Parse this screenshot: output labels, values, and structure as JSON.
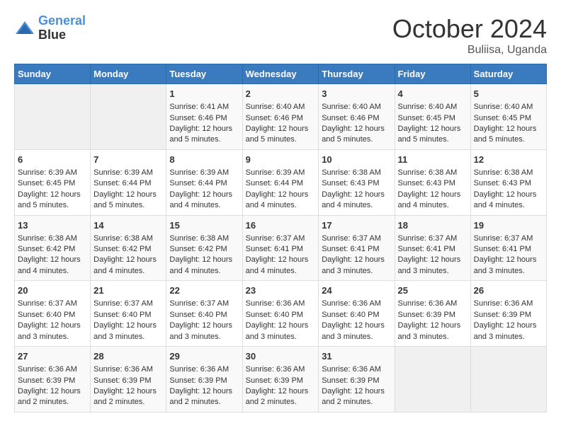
{
  "logo": {
    "line1": "General",
    "line2": "Blue"
  },
  "title": "October 2024",
  "subtitle": "Buliisa, Uganda",
  "days_of_week": [
    "Sunday",
    "Monday",
    "Tuesday",
    "Wednesday",
    "Thursday",
    "Friday",
    "Saturday"
  ],
  "weeks": [
    [
      {
        "day": "",
        "empty": true
      },
      {
        "day": "",
        "empty": true
      },
      {
        "day": "1",
        "sunrise": "6:41 AM",
        "sunset": "6:46 PM",
        "daylight": "12 hours and 5 minutes."
      },
      {
        "day": "2",
        "sunrise": "6:40 AM",
        "sunset": "6:46 PM",
        "daylight": "12 hours and 5 minutes."
      },
      {
        "day": "3",
        "sunrise": "6:40 AM",
        "sunset": "6:46 PM",
        "daylight": "12 hours and 5 minutes."
      },
      {
        "day": "4",
        "sunrise": "6:40 AM",
        "sunset": "6:45 PM",
        "daylight": "12 hours and 5 minutes."
      },
      {
        "day": "5",
        "sunrise": "6:40 AM",
        "sunset": "6:45 PM",
        "daylight": "12 hours and 5 minutes."
      }
    ],
    [
      {
        "day": "6",
        "sunrise": "6:39 AM",
        "sunset": "6:45 PM",
        "daylight": "12 hours and 5 minutes."
      },
      {
        "day": "7",
        "sunrise": "6:39 AM",
        "sunset": "6:44 PM",
        "daylight": "12 hours and 5 minutes."
      },
      {
        "day": "8",
        "sunrise": "6:39 AM",
        "sunset": "6:44 PM",
        "daylight": "12 hours and 4 minutes."
      },
      {
        "day": "9",
        "sunrise": "6:39 AM",
        "sunset": "6:44 PM",
        "daylight": "12 hours and 4 minutes."
      },
      {
        "day": "10",
        "sunrise": "6:38 AM",
        "sunset": "6:43 PM",
        "daylight": "12 hours and 4 minutes."
      },
      {
        "day": "11",
        "sunrise": "6:38 AM",
        "sunset": "6:43 PM",
        "daylight": "12 hours and 4 minutes."
      },
      {
        "day": "12",
        "sunrise": "6:38 AM",
        "sunset": "6:43 PM",
        "daylight": "12 hours and 4 minutes."
      }
    ],
    [
      {
        "day": "13",
        "sunrise": "6:38 AM",
        "sunset": "6:42 PM",
        "daylight": "12 hours and 4 minutes."
      },
      {
        "day": "14",
        "sunrise": "6:38 AM",
        "sunset": "6:42 PM",
        "daylight": "12 hours and 4 minutes."
      },
      {
        "day": "15",
        "sunrise": "6:38 AM",
        "sunset": "6:42 PM",
        "daylight": "12 hours and 4 minutes."
      },
      {
        "day": "16",
        "sunrise": "6:37 AM",
        "sunset": "6:41 PM",
        "daylight": "12 hours and 4 minutes."
      },
      {
        "day": "17",
        "sunrise": "6:37 AM",
        "sunset": "6:41 PM",
        "daylight": "12 hours and 3 minutes."
      },
      {
        "day": "18",
        "sunrise": "6:37 AM",
        "sunset": "6:41 PM",
        "daylight": "12 hours and 3 minutes."
      },
      {
        "day": "19",
        "sunrise": "6:37 AM",
        "sunset": "6:41 PM",
        "daylight": "12 hours and 3 minutes."
      }
    ],
    [
      {
        "day": "20",
        "sunrise": "6:37 AM",
        "sunset": "6:40 PM",
        "daylight": "12 hours and 3 minutes."
      },
      {
        "day": "21",
        "sunrise": "6:37 AM",
        "sunset": "6:40 PM",
        "daylight": "12 hours and 3 minutes."
      },
      {
        "day": "22",
        "sunrise": "6:37 AM",
        "sunset": "6:40 PM",
        "daylight": "12 hours and 3 minutes."
      },
      {
        "day": "23",
        "sunrise": "6:36 AM",
        "sunset": "6:40 PM",
        "daylight": "12 hours and 3 minutes."
      },
      {
        "day": "24",
        "sunrise": "6:36 AM",
        "sunset": "6:40 PM",
        "daylight": "12 hours and 3 minutes."
      },
      {
        "day": "25",
        "sunrise": "6:36 AM",
        "sunset": "6:39 PM",
        "daylight": "12 hours and 3 minutes."
      },
      {
        "day": "26",
        "sunrise": "6:36 AM",
        "sunset": "6:39 PM",
        "daylight": "12 hours and 3 minutes."
      }
    ],
    [
      {
        "day": "27",
        "sunrise": "6:36 AM",
        "sunset": "6:39 PM",
        "daylight": "12 hours and 2 minutes."
      },
      {
        "day": "28",
        "sunrise": "6:36 AM",
        "sunset": "6:39 PM",
        "daylight": "12 hours and 2 minutes."
      },
      {
        "day": "29",
        "sunrise": "6:36 AM",
        "sunset": "6:39 PM",
        "daylight": "12 hours and 2 minutes."
      },
      {
        "day": "30",
        "sunrise": "6:36 AM",
        "sunset": "6:39 PM",
        "daylight": "12 hours and 2 minutes."
      },
      {
        "day": "31",
        "sunrise": "6:36 AM",
        "sunset": "6:39 PM",
        "daylight": "12 hours and 2 minutes."
      },
      {
        "day": "",
        "empty": true
      },
      {
        "day": "",
        "empty": true
      }
    ]
  ]
}
